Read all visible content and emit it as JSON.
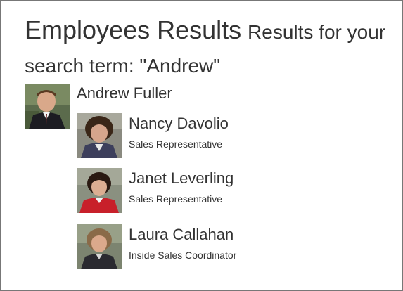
{
  "page": {
    "heading": "Employees Results",
    "subheading": "Results for your search term: \"Andrew\""
  },
  "manager": {
    "name": "Andrew Fuller",
    "photo_icon": "person-photo"
  },
  "reports": [
    {
      "name": "Nancy Davolio",
      "title": "Sales Representative",
      "photo_icon": "person-photo"
    },
    {
      "name": "Janet Leverling",
      "title": "Sales Representative",
      "photo_icon": "person-photo"
    },
    {
      "name": "Laura Callahan",
      "title": "Inside Sales Coordinator",
      "photo_icon": "person-photo"
    }
  ]
}
